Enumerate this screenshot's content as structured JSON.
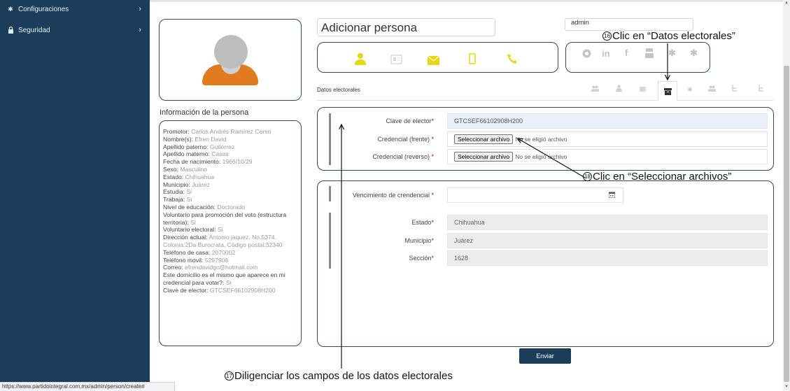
{
  "sidebar": {
    "items": [
      {
        "label": "Configuraciones",
        "icon": "gear-icon",
        "chevron": "›"
      },
      {
        "label": "Seguridad",
        "icon": "lock-icon",
        "chevron": "›"
      }
    ]
  },
  "status_bar": {
    "url": "https://www.partidointegral.com.mx/admin/person/create#"
  },
  "header": {
    "title": "Adicionar persona",
    "user": "admin"
  },
  "info": {
    "title": "Información de la persona",
    "lines": [
      {
        "label": "Promotor:",
        "value": "Carlos Andrés Ramírez Corso"
      },
      {
        "label": "Nombre(s):",
        "value": "Efren David"
      },
      {
        "label": "Apellido paterno:",
        "value": "Gutiérrez"
      },
      {
        "label": "Apellido materno:",
        "value": "Casas"
      },
      {
        "label": "Fecha de nacimiento:",
        "value": "1966/10/29"
      },
      {
        "label": "Sexo:",
        "value": "Masculino"
      },
      {
        "label": "Estado:",
        "value": "Chihuahua"
      },
      {
        "label": "Municipio:",
        "value": "Juárez"
      },
      {
        "label": "Estudia:",
        "value": "Si"
      },
      {
        "label": "Trabaja:",
        "value": "Si"
      },
      {
        "label": "Nivel de educación:",
        "value": "Doctorado"
      },
      {
        "label": "Voluntario para promoción del voto (estructura",
        "value": ""
      },
      {
        "label": "territoria):",
        "value": "Si"
      },
      {
        "label": "Voluntario electoral:",
        "value": "Si"
      },
      {
        "label": "Dirección actual:",
        "value": "Antonio jaquez, No.5374,"
      },
      {
        "label": "",
        "value": "Colonia:2Da Burocrata, Código postal:32340"
      },
      {
        "label": "Teléfono de casa:",
        "value": "2070002"
      },
      {
        "label": "Teléfono movil:",
        "value": "5297906"
      },
      {
        "label": "Correo:",
        "value": "efrendavidgc@hotmail.com"
      },
      {
        "label": "Este domicilio es el mismo que aparece en mi",
        "value": ""
      },
      {
        "label": "credencial para votar?:",
        "value": "Si"
      },
      {
        "label": "Clave de elector:",
        "value": "GTCSEF66102908H200"
      }
    ]
  },
  "tabs": {
    "section_label": "Datos electorales",
    "icons": [
      "users-icon",
      "user-icon",
      "envelope-icon",
      "archive-icon",
      "gear-icon",
      "users-icon",
      "sitemap-icon",
      "sitemap-icon"
    ],
    "active_index": 3
  },
  "icon_bar": {
    "yellow": [
      "user-icon",
      "id-card-icon",
      "envelope-icon",
      "mobile-icon",
      "phone-icon"
    ],
    "gray": [
      "chrome-icon",
      "linkedin-icon",
      "facebook-icon",
      "youtube-icon",
      "gear-icon",
      "gear-icon"
    ]
  },
  "form": {
    "clave": {
      "label": "Clave de elector",
      "value": "GTCSEF66102908H200"
    },
    "cred_frente": {
      "label": "Credencial (frente)",
      "button": "Seleccionar archivo",
      "status": "No se eligió archivo"
    },
    "cred_reverso": {
      "label": "Credencial (reverso)",
      "button": "Seleccionar archivo",
      "status": "No se eligió archivo"
    },
    "vencimiento": {
      "label": "Vencimiento de crendencial",
      "value": ""
    },
    "estado": {
      "label": "Estado",
      "value": "Chihuahua"
    },
    "municipio": {
      "label": "Municipio",
      "value": "Juárez"
    },
    "seccion": {
      "label": "Sección",
      "value": "1628"
    },
    "required_mark": "*",
    "submit": "Enviar"
  },
  "annotations": {
    "a16": {
      "num": "16",
      "text": "Clic en “Datos electorales”"
    },
    "a17": {
      "num": "17",
      "text": "Diligenciar los campos de los datos electorales"
    },
    "a18": {
      "num": "18",
      "text": "Clic en “Seleccionar archivos”"
    }
  }
}
